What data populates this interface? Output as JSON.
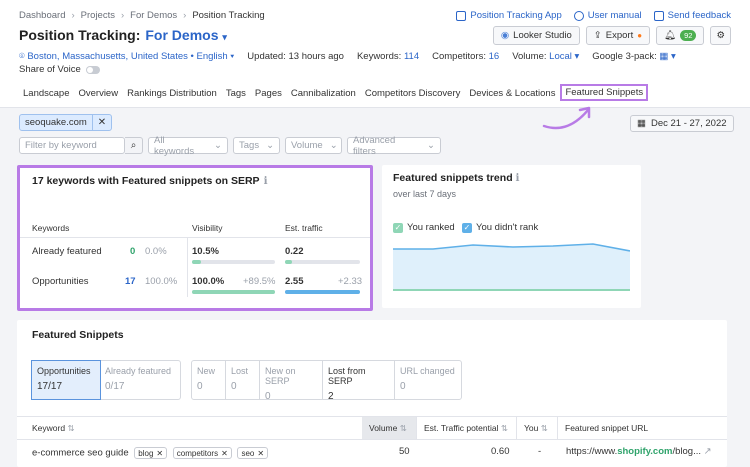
{
  "breadcrumb": {
    "items": [
      "Dashboard",
      "Projects",
      "For Demos",
      "Position Tracking"
    ]
  },
  "top_links": {
    "app": "Position Tracking App",
    "manual": "User manual",
    "feedback": "Send feedback"
  },
  "header": {
    "title": "Position Tracking:",
    "project": "For Demos"
  },
  "toolbar": {
    "looker": "Looker Studio",
    "export": "Export",
    "notif_count": "92"
  },
  "meta": {
    "location": "Boston, Massachusetts, United States",
    "language": "English",
    "updated": "Updated: 13 hours ago",
    "keywords_label": "Keywords:",
    "keywords_value": "114",
    "competitors_label": "Competitors:",
    "competitors_value": "16",
    "volume_label": "Volume:",
    "volume_value": "Local",
    "google_pack": "Google 3-pack:",
    "share_of_voice": "Share of Voice"
  },
  "tabs": [
    "Landscape",
    "Overview",
    "Rankings Distribution",
    "Tags",
    "Pages",
    "Cannibalization",
    "Competitors Discovery",
    "Devices & Locations",
    "Featured Snippets"
  ],
  "filters": {
    "domain_chip": "seoquake.com",
    "date_range": "Dec 21 - 27, 2022",
    "search_placeholder": "Filter by keyword",
    "all_keywords": "All keywords",
    "tags": "Tags",
    "volume": "Volume",
    "advanced": "Advanced filters"
  },
  "summary": {
    "title": "17 keywords with Featured snippets on SERP",
    "col_keywords": "Keywords",
    "col_visibility": "Visibility",
    "col_traffic": "Est. traffic",
    "rows": [
      {
        "label": "Already featured",
        "count": "0",
        "pct": "0.0%",
        "visibility": "10.5%",
        "vis_delta": "",
        "traffic": "0.22",
        "traffic_delta": "",
        "vis_fill": 0.105,
        "traffic_fill": 0.09
      },
      {
        "label": "Opportunities",
        "count": "17",
        "pct": "100.0%",
        "visibility": "100.0%",
        "vis_delta": "+89.5%",
        "traffic": "2.55",
        "traffic_delta": "+2.33",
        "vis_fill": 1.0,
        "traffic_fill": 1.0
      }
    ]
  },
  "trend": {
    "title": "Featured snippets trend",
    "subtitle": "over last 7 days",
    "legend_ranked": "You ranked",
    "legend_not_ranked": "You didn't rank",
    "ranked_color": "#8fd6b6",
    "not_ranked_color": "#5fb0e8"
  },
  "snippets": {
    "title": "Featured Snippets",
    "segments_a": [
      {
        "label": "Opportunities",
        "value": "17/17",
        "active": true
      },
      {
        "label": "Already featured",
        "value": "0/17",
        "active": false
      }
    ],
    "segments_b": [
      {
        "label": "New",
        "value": "0"
      },
      {
        "label": "Lost",
        "value": "0"
      },
      {
        "label": "New on SERP",
        "value": "0"
      },
      {
        "label": "Lost from SERP",
        "value": "2"
      },
      {
        "label": "URL changed",
        "value": "0"
      }
    ],
    "columns": [
      "Keyword",
      "Volume",
      "Est. Traffic potential",
      "You",
      "Featured snippet URL"
    ],
    "row": {
      "keyword": "e-commerce seo guide",
      "tags": [
        "blog",
        "competitors",
        "seo"
      ],
      "volume": "50",
      "traffic": "0.60",
      "you": "-",
      "url_prefix": "https://www.",
      "url_bold": "shopify.com",
      "url_suffix": "/blog..."
    }
  }
}
